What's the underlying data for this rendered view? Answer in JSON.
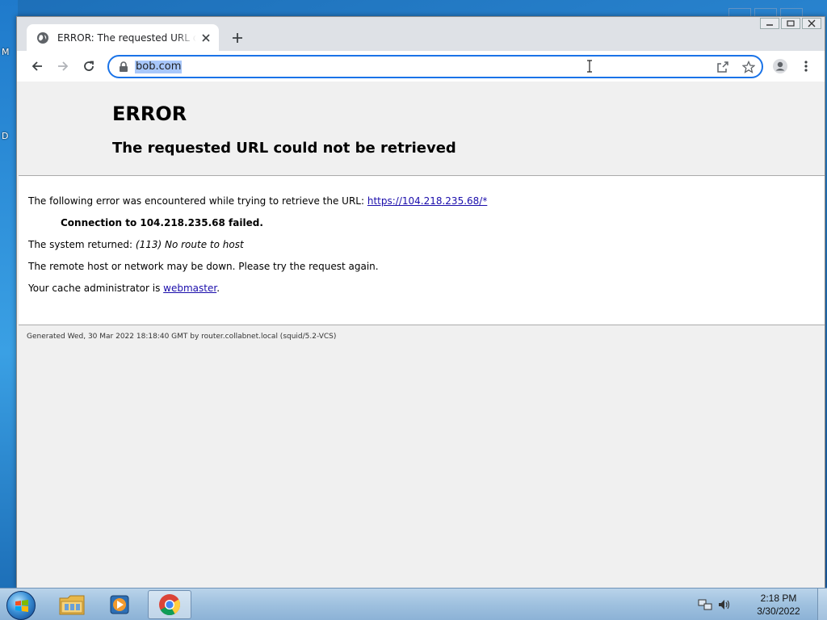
{
  "desktop": {
    "left_fragments": [
      "M",
      "D"
    ]
  },
  "browser": {
    "tab": {
      "title": "ERROR: The requested URL could not be retrieved"
    },
    "omnibox": {
      "url": "bob.com"
    }
  },
  "page": {
    "heading": "ERROR",
    "subheading": "The requested URL could not be retrieved",
    "line1_prefix": "The following error was encountered while trying to retrieve the URL: ",
    "line1_link": "https://104.218.235.68/*",
    "connection": "Connection to 104.218.235.68 failed.",
    "system_prefix": "The system returned: ",
    "system_value": "(113) No route to host",
    "remote_note": "The remote host or network may be down. Please try the request again.",
    "cache_prefix": "Your cache administrator is ",
    "cache_link": "webmaster",
    "cache_suffix": ".",
    "footer": "Generated Wed, 30 Mar 2022 18:18:40 GMT by router.collabnet.local (squid/5.2-VCS)"
  },
  "taskbar": {
    "pinned": [
      "file-explorer-icon",
      "media-player-icon",
      "chrome-icon"
    ],
    "clock_time": "2:18 PM",
    "clock_date": "3/30/2022"
  },
  "colors": {
    "accent": "#1a73e8",
    "link": "#1a0dab",
    "selection": "#a8c7fa"
  }
}
